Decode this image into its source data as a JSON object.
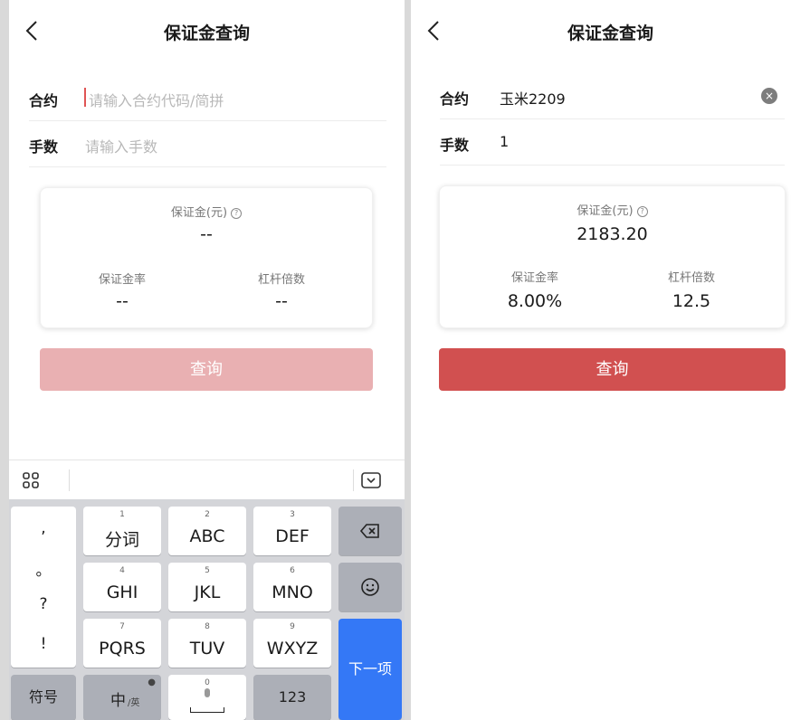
{
  "left": {
    "title": "保证金查询",
    "contract_label": "合约",
    "contract_placeholder": "请输入合约代码/简拼",
    "lots_label": "手数",
    "lots_placeholder": "请输入手数",
    "margin_caption": "保证金(元)",
    "margin_value": "--",
    "rate_caption": "保证金率",
    "rate_value": "--",
    "leverage_caption": "杠杆倍数",
    "leverage_value": "--",
    "query_label": "查询",
    "query_color": "#e9b0b2"
  },
  "right": {
    "title": "保证金查询",
    "contract_label": "合约",
    "contract_value": "玉米2209",
    "lots_label": "手数",
    "lots_value": "1",
    "margin_caption": "保证金(元)",
    "margin_value": "2183.20",
    "rate_caption": "保证金率",
    "rate_value": "8.00%",
    "leverage_caption": "杠杆倍数",
    "leverage_value": "12.5",
    "query_label": "查询",
    "query_color": "#d15050"
  },
  "keyboard": {
    "punct": [
      ",",
      "。",
      "?",
      "!"
    ],
    "keys": [
      {
        "sub": "1",
        "main": "分词"
      },
      {
        "sub": "2",
        "main": "ABC"
      },
      {
        "sub": "3",
        "main": "DEF"
      },
      {
        "sub": "4",
        "main": "GHI"
      },
      {
        "sub": "5",
        "main": "JKL"
      },
      {
        "sub": "6",
        "main": "MNO"
      },
      {
        "sub": "7",
        "main": "PQRS"
      },
      {
        "sub": "8",
        "main": "TUV"
      },
      {
        "sub": "9",
        "main": "WXYZ"
      }
    ],
    "symbol_label": "符号",
    "lang_label": "中",
    "lang_sub": "/英",
    "space_sub": "0",
    "num_label": "123",
    "next_label": "下一项",
    "next_color": "#3478f6"
  }
}
